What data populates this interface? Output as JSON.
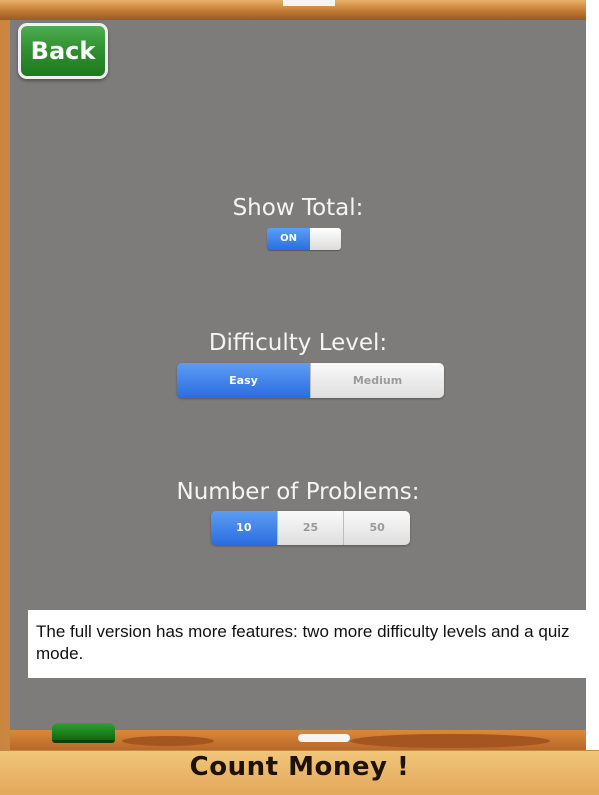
{
  "header": {
    "back_label": "Back"
  },
  "settings": {
    "show_total": {
      "label": "Show Total:",
      "state": "ON",
      "on": true
    },
    "difficulty": {
      "label": "Difficulty Level:",
      "options": [
        "Easy",
        "Medium"
      ],
      "selected": "Easy"
    },
    "problems": {
      "label": "Number of Problems:",
      "options": [
        "10",
        "25",
        "50"
      ],
      "selected": "10"
    }
  },
  "info": {
    "text": "The full version has more features:  two more difficulty levels and a quiz mode."
  },
  "footer": {
    "title": "Count Money !"
  },
  "colors": {
    "accent": "#2a6fe0",
    "back_button": "#2e8f2e",
    "board": "#7e7c7a"
  },
  "icons": {
    "tray_marker": "eraser-icon",
    "tray_chalk": "chalk-icon"
  }
}
